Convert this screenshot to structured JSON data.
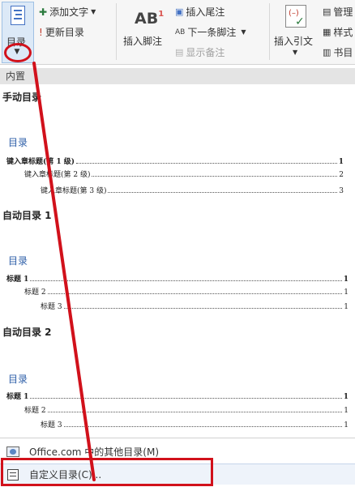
{
  "ribbon": {
    "toc_button_label": "目录",
    "add_text_label": "添加文字",
    "update_toc_label": "更新目录",
    "ab_icon_text": "AB",
    "ab_icon_sup": "1",
    "insert_footnote_label": "插入脚注",
    "insert_endnote_label": "插入尾注",
    "next_footnote_label": "下一条脚注",
    "show_notes_label": "显示备注",
    "insert_citation_label": "插入引文",
    "manage_label": "管理",
    "style_label": "样式",
    "bibliography_label": "书目"
  },
  "panel": {
    "section_header": "内置",
    "galleries": [
      {
        "title": "手动目录",
        "heading": "目录",
        "entries": [
          {
            "text": "键入章标题(第 1 级)",
            "page": "1"
          },
          {
            "text": "键入章标题(第 2 级)",
            "page": "2"
          },
          {
            "text": "键入章标题(第 3 级)",
            "page": "3"
          }
        ]
      },
      {
        "title": "自动目录 1",
        "heading": "目录",
        "entries": [
          {
            "text": "标题 1",
            "page": "1"
          },
          {
            "text": "标题 2",
            "page": "1"
          },
          {
            "text": "标题 3",
            "page": "1"
          }
        ]
      },
      {
        "title": "自动目录 2",
        "heading": "目录",
        "entries": [
          {
            "text": "标题 1",
            "page": "1"
          },
          {
            "text": "标题 2",
            "page": "1"
          },
          {
            "text": "标题 3",
            "page": "1"
          }
        ]
      }
    ],
    "office_more_label": "Office.com 中的其他目录(M)",
    "custom_toc_label": "自定义目录(C)..."
  },
  "colors": {
    "annotation_red": "#d1111b",
    "toc_heading_blue": "#2e5fa8"
  }
}
